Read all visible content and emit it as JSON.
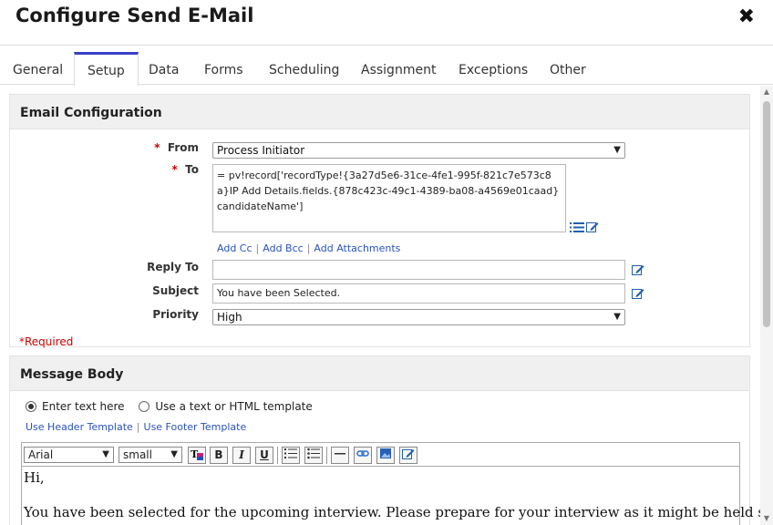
{
  "dialog": {
    "title": "Configure Send E-Mail",
    "close_symbol": "✖"
  },
  "tabs": [
    {
      "label": "General"
    },
    {
      "label": "Setup"
    },
    {
      "label": "Data"
    },
    {
      "label": "Forms"
    },
    {
      "label": "Scheduling"
    },
    {
      "label": "Assignment"
    },
    {
      "label": "Exceptions"
    },
    {
      "label": "Other"
    }
  ],
  "active_tab": "Setup",
  "email_config": {
    "heading": "Email Configuration",
    "from": {
      "label": "From",
      "value": "Process Initiator"
    },
    "to": {
      "label": "To",
      "value": "= pv!record['recordType!{3a27d5e6-31ce-4fe1-995f-821c7e573c8a}IP Add Details.fields.{878c423c-49c1-4389-ba08-a4569e01caad}candidateName']"
    },
    "links": {
      "add_cc": "Add Cc",
      "add_bcc": "Add Bcc",
      "add_attachments": "Add Attachments",
      "separator": "|"
    },
    "reply_to": {
      "label": "Reply To",
      "value": ""
    },
    "subject": {
      "label": "Subject",
      "value": "You have been Selected."
    },
    "priority": {
      "label": "Priority",
      "value": "High"
    },
    "required_marker": "*",
    "required_note": "*Required"
  },
  "message_body": {
    "heading": "Message Body",
    "option_enter_text": "Enter text here",
    "option_template": "Use a text or HTML template",
    "selected_option": "Enter text here",
    "header_template_link": "Use Header Template",
    "footer_template_link": "Use Footer Template",
    "font_family": "Arial",
    "font_size": "small",
    "body_line1": "Hi,",
    "body_line2": "You have been selected for the upcoming interview. Please prepare for your interview as it might be held soon"
  },
  "colors": {
    "accent": "#3b3fc8",
    "link": "#2a52be",
    "required": "#cc0000",
    "panel_header_bg": "#f0f0f0"
  }
}
